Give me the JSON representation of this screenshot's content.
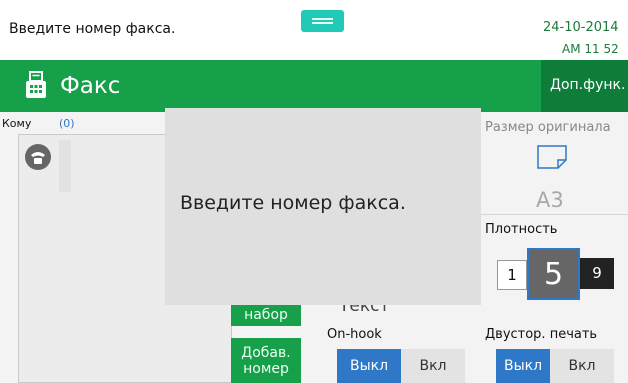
{
  "status": {
    "message": "Введите номер факса.",
    "date": "24-10-2014",
    "time": "AM 11 52"
  },
  "header": {
    "title": "Факс",
    "more_functions": "Доп.функ."
  },
  "destination": {
    "label": "Кому",
    "count": "(0)"
  },
  "original_size": {
    "label": "Размер оригинала",
    "value": "A3"
  },
  "density": {
    "label": "Плотность",
    "low": "1",
    "current": "5",
    "high": "9"
  },
  "onhook": {
    "label": "On-hook",
    "off": "Выкл",
    "on": "Вкл"
  },
  "duplex": {
    "label": "Двустор. печать",
    "off": "Выкл",
    "on": "Вкл"
  },
  "buttons": {
    "speed_dial": "набор",
    "add_number_line1": "Добав.",
    "add_number_line2": "номер"
  },
  "text_mode": "Текст",
  "popup": {
    "message": "Введите номер факса."
  },
  "colors": {
    "brand_green": "#16a04a",
    "selected_blue": "#2f78c7",
    "handle_teal": "#21c9b7"
  }
}
